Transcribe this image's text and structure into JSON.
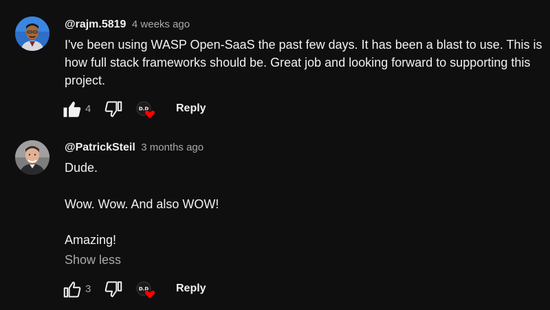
{
  "comments": [
    {
      "author": "@rajm.5819",
      "time": "4 weeks ago",
      "lines": [
        "I've been using WASP Open-SaaS the past few days. It has been a blast to use. This is",
        "how full stack frameworks should be. Great job and looking forward to supporting this",
        "project."
      ],
      "likes": "4",
      "liked": true,
      "reply_label": "Reply",
      "creator_badge": "D.D"
    },
    {
      "author": "@PatrickSteil",
      "time": "3 months ago",
      "paragraphs": [
        "Dude.",
        "Wow. Wow. And also WOW!",
        "Amazing!"
      ],
      "show_less_label": "Show less",
      "likes": "3",
      "liked": false,
      "reply_label": "Reply",
      "creator_badge": "D.D"
    }
  ],
  "colors": {
    "background": "#0f0f0f",
    "text": "#f1f1f1",
    "secondary_text": "#aaaaaa",
    "heart": "#ff0000"
  },
  "icons": [
    "thumb-up-icon",
    "thumb-down-icon",
    "heart-icon"
  ]
}
